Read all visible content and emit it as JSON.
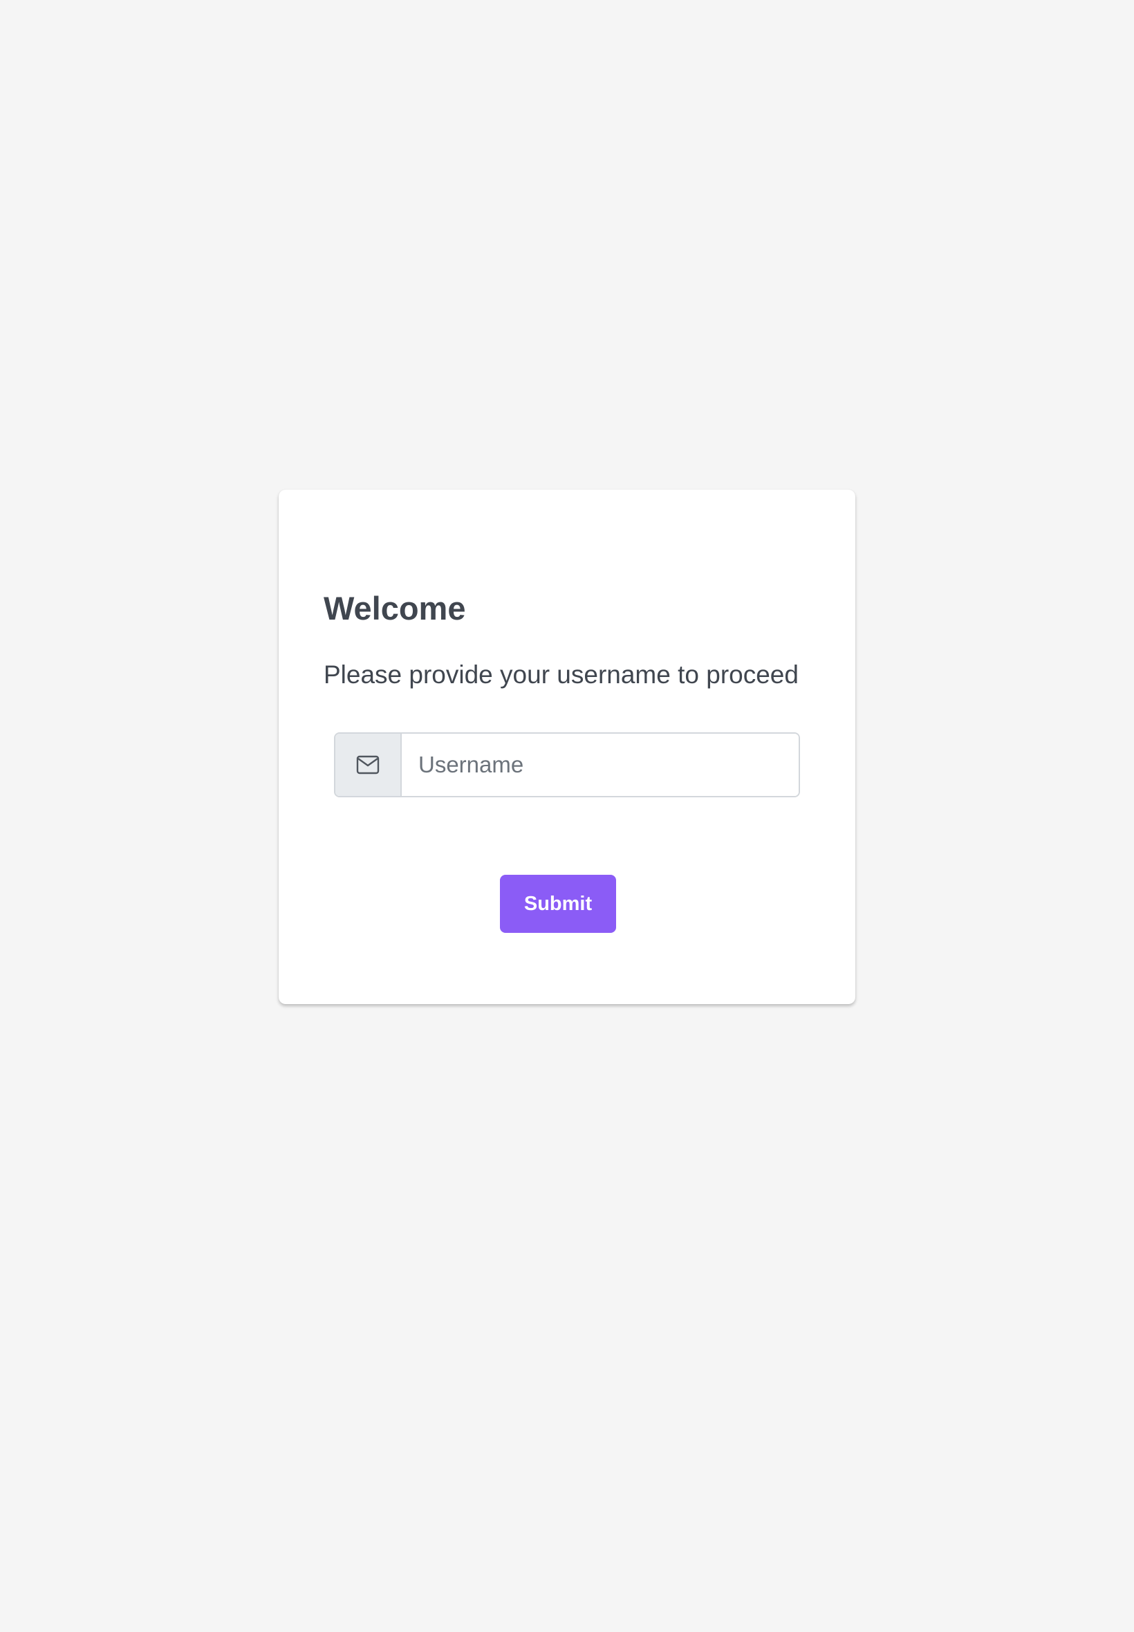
{
  "form": {
    "title": "Welcome",
    "subtitle": "Please provide your username to proceed",
    "username_input": {
      "icon": "mail-icon",
      "placeholder": "Username",
      "value": ""
    },
    "submit_label": "Submit"
  },
  "colors": {
    "page_background": "#f5f5f5",
    "card_background": "#ffffff",
    "accent": "#8b5cf6",
    "text": "#40464f",
    "addon_background": "#e8ebee",
    "border": "#d3d7dc"
  }
}
